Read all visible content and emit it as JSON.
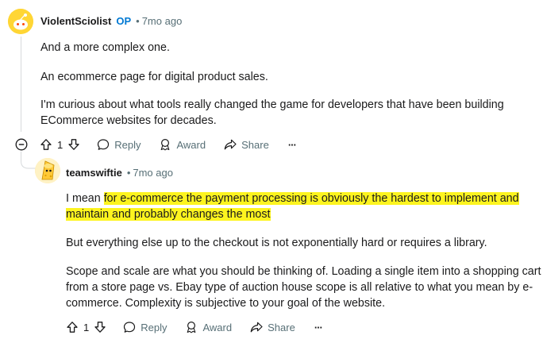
{
  "comment1": {
    "username": "ViolentSciolist",
    "op_badge": "OP",
    "separator": "•",
    "time": "7mo ago",
    "paragraphs": [
      "And a more complex one.",
      "An ecommerce page for digital product sales.",
      "I'm curious about what tools really changed the game for developers that have been building",
      "ECommerce websites for decades."
    ],
    "actions": {
      "votes": "1",
      "reply": "Reply",
      "award": "Award",
      "share": "Share",
      "more": "···"
    }
  },
  "comment2": {
    "username": "teamswiftie",
    "separator": "•",
    "time": "7mo ago",
    "p1_prefix": "I mean ",
    "p1_highlight_line1": "for e-commerce the payment processing is obviously the hardest to implement and",
    "p1_highlight_line2": "maintain and probably changes the most",
    "p2": "But everything else up to the checkout is not exponentially hard or requires a library.",
    "p3_lines": [
      "Scope and scale are what you should be thinking of. Loading a single item into a shopping cart",
      "from a store page vs. Ebay type of auction house scope is all relative to what you mean by e-",
      "commerce. Complexity is subjective to your goal of the website."
    ],
    "actions": {
      "votes": "1",
      "reply": "Reply",
      "award": "Award",
      "share": "Share",
      "more": "···"
    }
  },
  "colors": {
    "highlight": "#fdf41f",
    "op": "#0079d3",
    "meta": "#576f76",
    "thread": "#d7dadc"
  },
  "icons": [
    "avatar-snoo",
    "avatar-cheese",
    "collapse-icon",
    "upvote-icon",
    "downvote-icon",
    "reply-icon",
    "award-icon",
    "share-icon",
    "more-icon"
  ]
}
